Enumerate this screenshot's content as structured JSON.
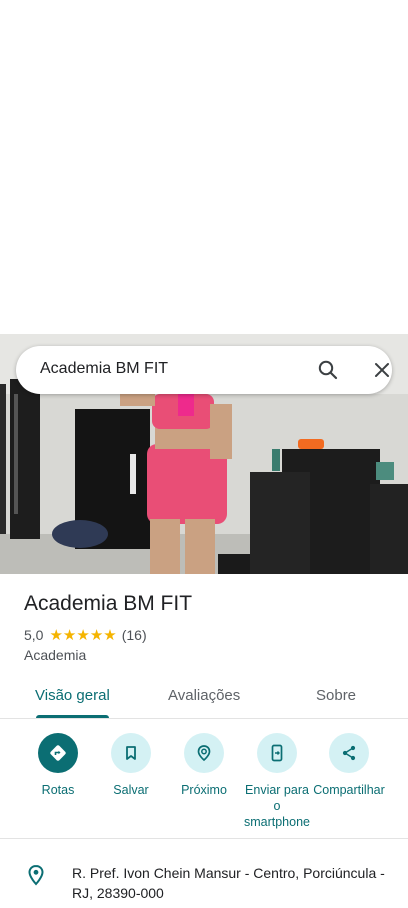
{
  "search": {
    "query": "Academia BM FIT"
  },
  "place": {
    "name": "Academia BM FIT",
    "rating": "5,0",
    "stars": 5,
    "review_count": "(16)",
    "category": "Academia"
  },
  "tabs": [
    {
      "label": "Visão geral",
      "active": true
    },
    {
      "label": "Avaliações",
      "active": false
    },
    {
      "label": "Sobre",
      "active": false
    }
  ],
  "actions": [
    {
      "label": "Rotas",
      "icon": "directions-icon"
    },
    {
      "label": "Salvar",
      "icon": "bookmark-icon"
    },
    {
      "label": "Próximo",
      "icon": "nearby-icon"
    },
    {
      "label": "Enviar para o smartphone",
      "icon": "send-to-phone-icon"
    },
    {
      "label": "Compartilhar",
      "icon": "share-icon"
    }
  ],
  "address": {
    "text": "R. Pref. Ivon Chein Mansur - Centro, Porciúncula - RJ, 28390-000",
    "icon": "location-pin-icon"
  },
  "colors": {
    "accent": "#0b6e73",
    "accent_light": "#d4f1f4",
    "star": "#f5b400"
  }
}
